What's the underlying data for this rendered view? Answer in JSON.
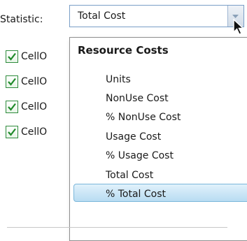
{
  "statistic": {
    "label": "Statistic:",
    "selected_value": "Total Cost"
  },
  "checkbox_rows": [
    {
      "label": "CellO",
      "checked": true
    },
    {
      "label": "CellO",
      "checked": true
    },
    {
      "label": "CellO",
      "checked": true
    },
    {
      "label": "CellO",
      "checked": true
    }
  ],
  "dropdown": {
    "group_header": "Resource Costs",
    "items": [
      {
        "label": "Units",
        "selected": false
      },
      {
        "label": "NonUse Cost",
        "selected": false
      },
      {
        "label": "% NonUse Cost",
        "selected": false
      },
      {
        "label": "Usage Cost",
        "selected": false
      },
      {
        "label": "% Usage Cost",
        "selected": false
      },
      {
        "label": "Total Cost",
        "selected": true
      },
      {
        "label": "% Total Cost",
        "selected": false
      }
    ]
  },
  "colors": {
    "checkbox_border": "#2e8b3c",
    "checkmark": "#1f8a2a",
    "highlight_border": "#7bb7da",
    "highlight_fill": "#b8dcf2",
    "select_border": "#7a9ec7"
  },
  "icons": {
    "dropdown_arrow": "chevron-down-icon",
    "checkbox_check": "checkmark-icon",
    "cursor": "mouse-pointer-icon"
  }
}
